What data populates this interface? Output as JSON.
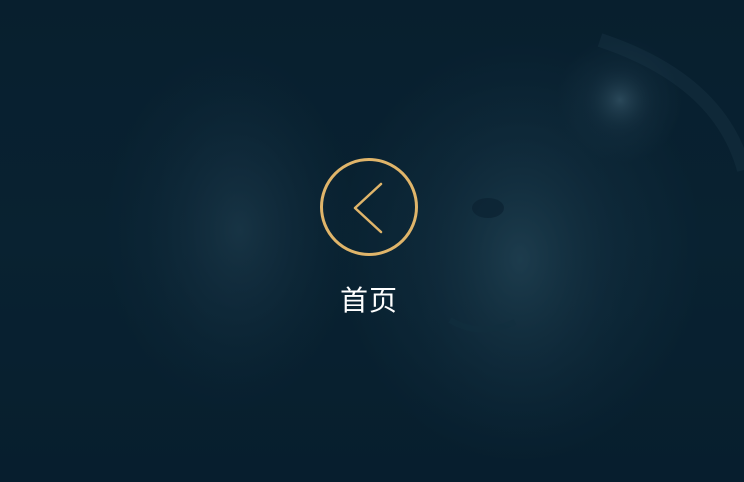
{
  "back_button": {
    "label": "首页",
    "icon": "chevron-left-icon",
    "accent_color": "#e0b56a",
    "label_color": "#ffffff"
  },
  "background": {
    "tint_color": "#0a2233"
  }
}
